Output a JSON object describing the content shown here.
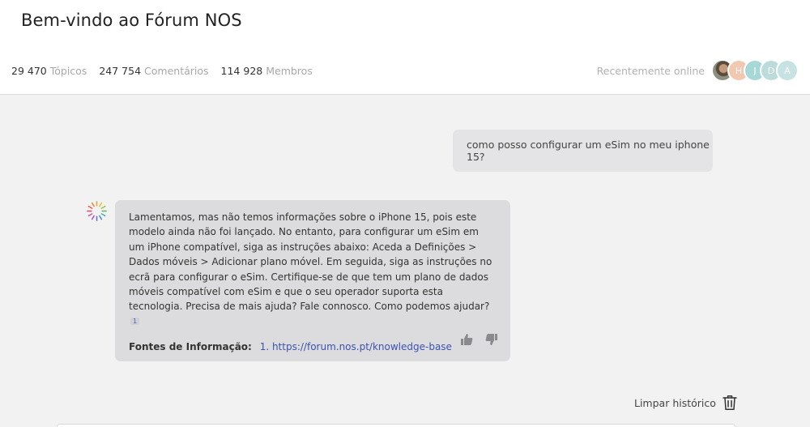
{
  "header": {
    "title": "Bem-vindo ao Fórum NOS",
    "stats": [
      {
        "value": "29 470",
        "label": "Tópicos"
      },
      {
        "value": "247 754",
        "label": "Comentários"
      },
      {
        "value": "114 928",
        "label": "Membros"
      }
    ],
    "online": {
      "label": "Recentemente online",
      "avatars": [
        {
          "initial": "",
          "icon": "user-photo",
          "color": "#8d8f7f"
        },
        {
          "initial": "H",
          "color": "#f1c9b0"
        },
        {
          "initial": "J",
          "color": "#a7d8d8"
        },
        {
          "initial": "D",
          "color": "#bcdcdc"
        },
        {
          "initial": "A",
          "color": "#c6e2e2"
        }
      ]
    }
  },
  "chat": {
    "user_message": "como posso configurar um eSim no meu iphone 15?",
    "bot_message": "Lamentamos, mas não temos informações sobre o iPhone 15, pois este modelo ainda não foi lançado. No entanto, para configurar um eSim em um iPhone compatível, siga as instruções abaixo: Aceda a Definições > Dados móveis > Adicionar plano móvel. Em seguida, siga as instruções no ecrã para configurar o eSim. Certifique-se de que tem um plano de dados móveis compatível com eSim e que o seu operador suporta esta tecnologia. Precisa de mais ajuda? Fale connosco. Como podemos ajudar?",
    "citation": "1",
    "sources_label": "Fontes de Informação:",
    "source_link": "1. https://forum.nos.pt/knowledge-base",
    "feedback_icons": [
      "thumbs-up-icon",
      "thumbs-down-icon"
    ]
  },
  "footer": {
    "clear_label": "Limpar histórico",
    "clear_icon": "trash-icon"
  },
  "colors": {
    "link": "#3b52b0",
    "bubble_user": "#e4e4e6",
    "bubble_bot": "#dcdcde",
    "background": "#f2f2f3"
  }
}
